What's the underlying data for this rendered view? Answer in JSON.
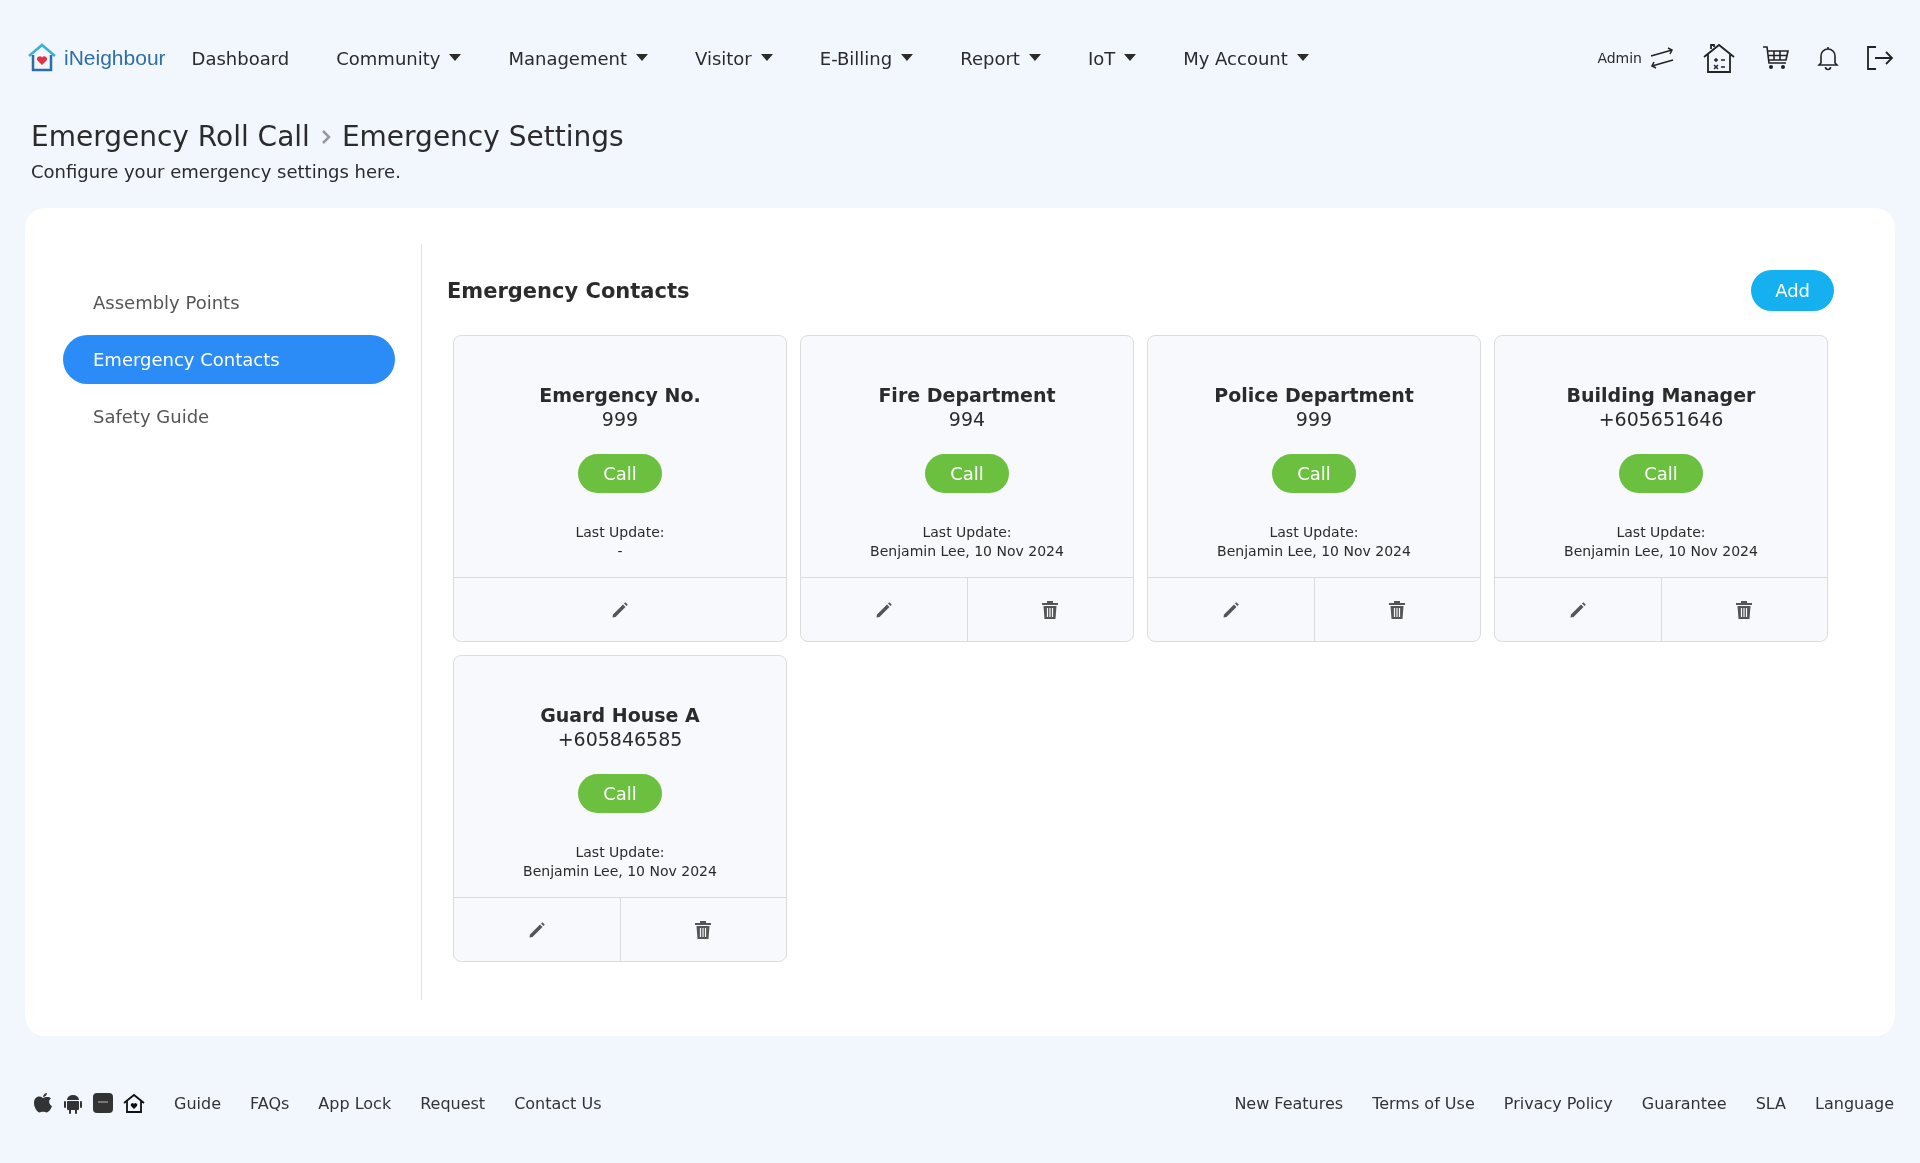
{
  "brand": {
    "name": "iNeighbour"
  },
  "nav": [
    {
      "label": "Dashboard",
      "dropdown": false
    },
    {
      "label": "Community",
      "dropdown": true
    },
    {
      "label": "Management",
      "dropdown": true
    },
    {
      "label": "Visitor",
      "dropdown": true
    },
    {
      "label": "E-Billing",
      "dropdown": true
    },
    {
      "label": "Report",
      "dropdown": true
    },
    {
      "label": "IoT",
      "dropdown": true
    },
    {
      "label": "My Account",
      "dropdown": true
    }
  ],
  "user": {
    "role": "Admin"
  },
  "page": {
    "breadcrumb": [
      "Emergency Roll Call",
      "Emergency Settings"
    ],
    "subtitle": "Configure your emergency settings here."
  },
  "sidebar": {
    "items": [
      {
        "label": "Assembly Points",
        "selected": false
      },
      {
        "label": "Emergency Contacts",
        "selected": true
      },
      {
        "label": "Safety Guide",
        "selected": false
      }
    ]
  },
  "section": {
    "title": "Emergency Contacts",
    "add_button": "Add"
  },
  "contacts": [
    {
      "name": "Emergency No.",
      "number": "999",
      "call": "Call",
      "update_label": "Last Update:",
      "update": "-",
      "deletable": false
    },
    {
      "name": "Fire Department",
      "number": "994",
      "call": "Call",
      "update_label": "Last Update:",
      "update": "Benjamin Lee, 10 Nov 2024",
      "deletable": true
    },
    {
      "name": "Police Department",
      "number": "999",
      "call": "Call",
      "update_label": "Last Update:",
      "update": "Benjamin Lee, 10 Nov 2024",
      "deletable": true
    },
    {
      "name": "Building Manager",
      "number": "+605651646",
      "call": "Call",
      "update_label": "Last Update:",
      "update": "Benjamin Lee, 10 Nov 2024",
      "deletable": true
    },
    {
      "name": "Guard House A",
      "number": "+605846585",
      "call": "Call",
      "update_label": "Last Update:",
      "update": "Benjamin Lee, 10 Nov 2024",
      "deletable": true
    }
  ],
  "footer": {
    "left_links": [
      "Guide",
      "FAQs",
      "App Lock",
      "Request",
      "Contact Us"
    ],
    "right_links": [
      "New Features",
      "Terms of Use",
      "Privacy Policy",
      "Guarantee",
      "SLA",
      "Language"
    ]
  }
}
